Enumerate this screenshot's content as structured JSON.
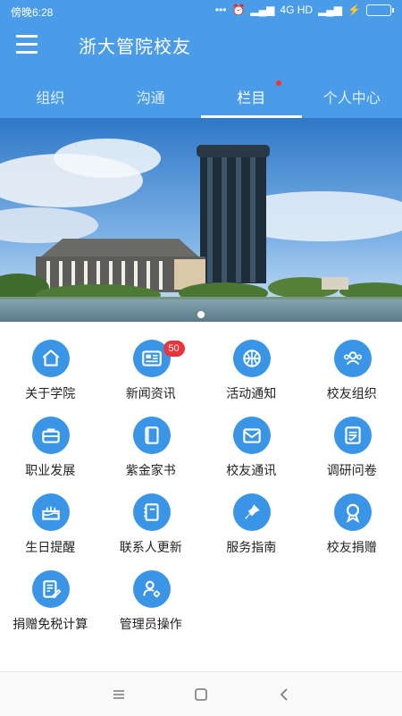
{
  "status_bar": {
    "time": "傍晚6:28",
    "signal": "4G HD"
  },
  "app": {
    "title": "浙大管院校友"
  },
  "tabs": [
    {
      "label": "组织",
      "active": false
    },
    {
      "label": "沟通",
      "active": false
    },
    {
      "label": "栏目",
      "active": true,
      "has_dot": true
    },
    {
      "label": "个人中心",
      "active": false
    }
  ],
  "carousel": {
    "current_index": 0
  },
  "colors": {
    "primary": "#4a9ce8",
    "icon": "#3a95e7",
    "badge": "#e8343a"
  },
  "menu": [
    {
      "label": "关于学院",
      "icon": "home-icon"
    },
    {
      "label": "新闻资讯",
      "icon": "newspaper-icon",
      "badge": "50"
    },
    {
      "label": "活动通知",
      "icon": "basketball-icon"
    },
    {
      "label": "校友组织",
      "icon": "group-icon"
    },
    {
      "label": "职业发展",
      "icon": "briefcase-icon"
    },
    {
      "label": "紫金家书",
      "icon": "book-icon"
    },
    {
      "label": "校友通讯",
      "icon": "mail-icon"
    },
    {
      "label": "调研问卷",
      "icon": "survey-icon"
    },
    {
      "label": "生日提醒",
      "icon": "cake-icon"
    },
    {
      "label": "联系人更新",
      "icon": "contacts-icon"
    },
    {
      "label": "服务指南",
      "icon": "pin-icon"
    },
    {
      "label": "校友捐赠",
      "icon": "award-icon"
    },
    {
      "label": "捐赠免税计算",
      "icon": "calculator-edit-icon"
    },
    {
      "label": "管理员操作",
      "icon": "admin-user-icon"
    }
  ]
}
